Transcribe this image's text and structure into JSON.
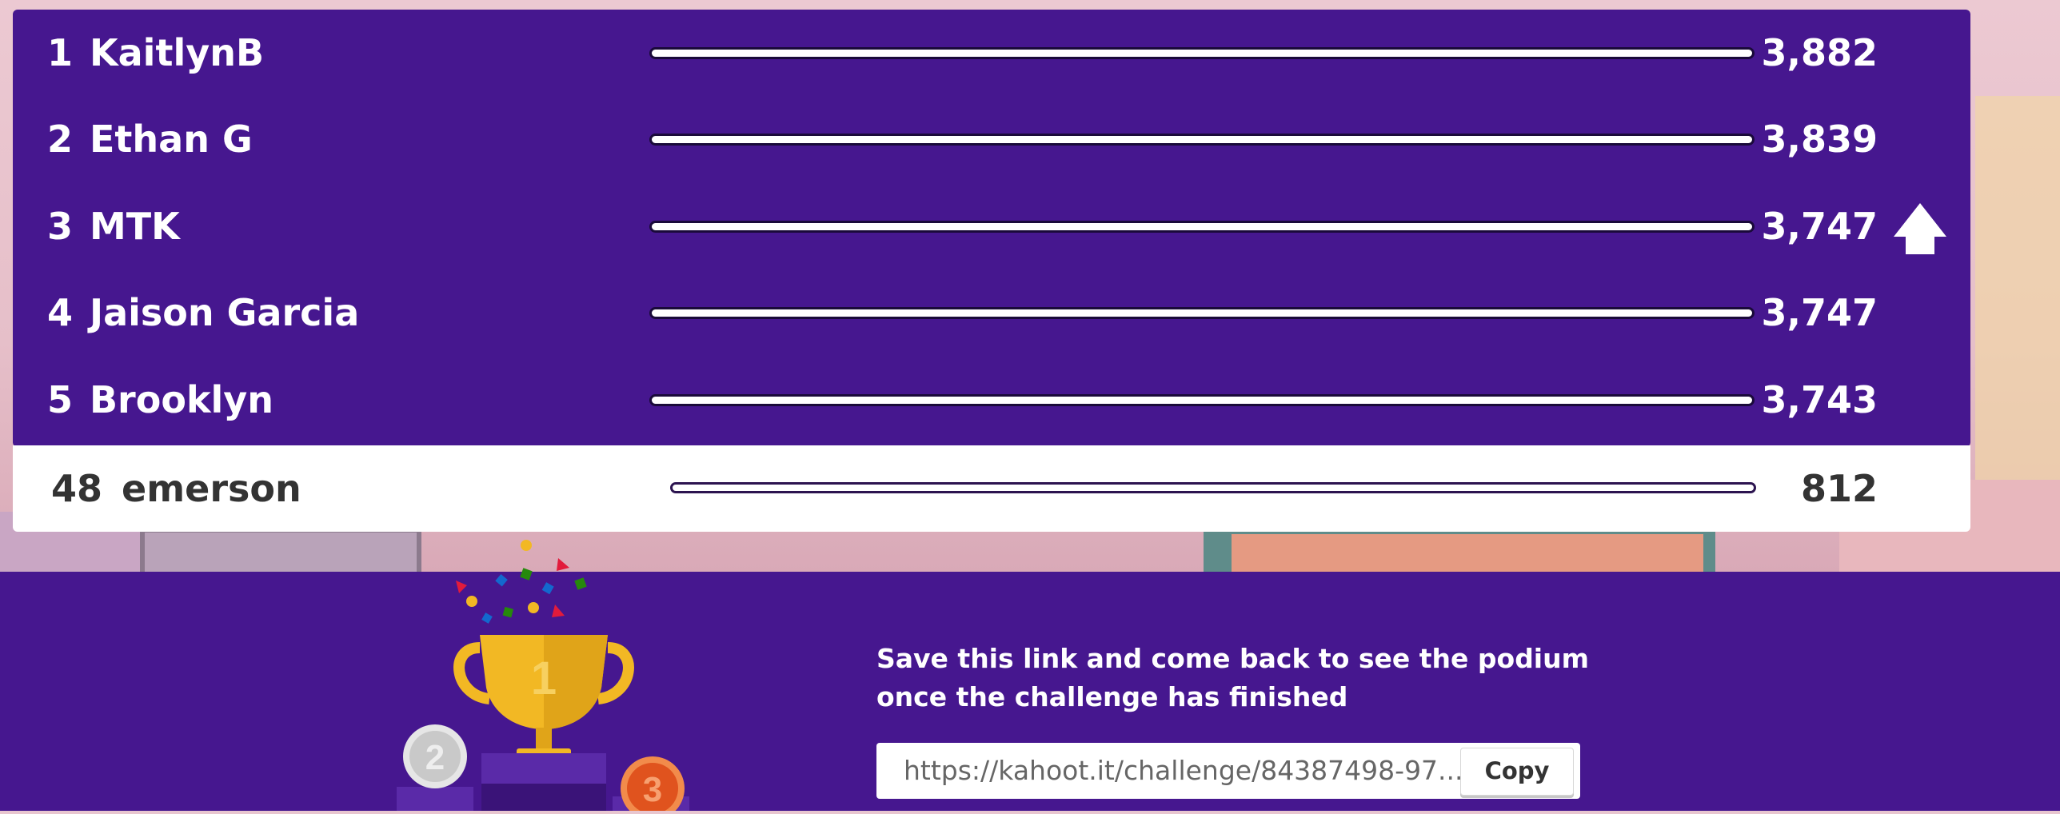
{
  "leaderboard": {
    "rows": [
      {
        "rank": "1",
        "name": "KaitlynB",
        "score": "3,882"
      },
      {
        "rank": "2",
        "name": "Ethan G",
        "score": "3,839"
      },
      {
        "rank": "3",
        "name": "MTK",
        "score": "3,747"
      },
      {
        "rank": "4",
        "name": "Jaison Garcia",
        "score": "3,747"
      },
      {
        "rank": "5",
        "name": "Brooklyn",
        "score": "3,743"
      }
    ],
    "current_player": {
      "rank": "48",
      "name": "emerson",
      "score": "812"
    },
    "trend_icon": "up-arrow-icon"
  },
  "footer": {
    "message_line1": "Save this link and come back to see the podium",
    "message_line2": "once the challenge has finished",
    "link_value": "https://kahoot.it/challenge/84387498-97...",
    "copy_label": "Copy",
    "trophy_icon": "trophy-podium-illustration",
    "podium_labels": [
      "1",
      "2",
      "3"
    ]
  },
  "colors": {
    "brand_purple": "#46178f",
    "highlight_row": "#ffffff",
    "gold": "#f2b824",
    "silver": "#c9c9c9",
    "bronze": "#e0531e"
  }
}
